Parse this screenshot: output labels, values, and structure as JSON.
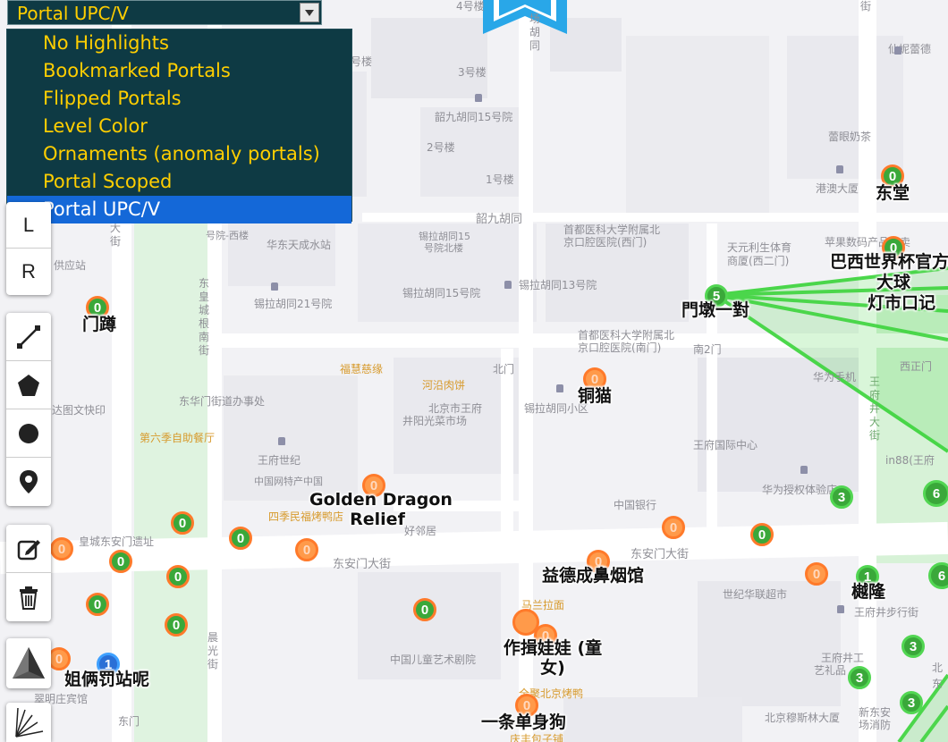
{
  "layer_select": {
    "selected": "Portal UPC/V",
    "options": [
      {
        "label": "No Highlights",
        "checked": false
      },
      {
        "label": "Bookmarked Portals",
        "checked": false
      },
      {
        "label": "Flipped Portals",
        "checked": false
      },
      {
        "label": "Level Color",
        "checked": false
      },
      {
        "label": "Ornaments (anomaly portals)",
        "checked": false
      },
      {
        "label": "Portal Scoped",
        "checked": false
      },
      {
        "label": "Portal UPC/V",
        "checked": true
      }
    ],
    "check_mark": "✓"
  },
  "toolbar": {
    "zoom_l": "L",
    "zoom_r": "R",
    "draw_icons": [
      "polyline-icon",
      "polygon-icon",
      "circle-icon",
      "marker-icon"
    ],
    "edit_icons": [
      "edit-icon",
      "trash-icon"
    ],
    "bottom_icons": [
      "layer-pyramid-icon",
      "starburst-icon"
    ]
  },
  "portal_labels": {
    "mendun": "門墩一對",
    "brazil": "巴西世界杯官方",
    "dadeng": "大球",
    "dengshi": "灯市口记",
    "dongtang": "东堂",
    "mendun2": "门蹲",
    "tongmao": "铜猫",
    "golden_dragon_1": "Golden Dragon",
    "golden_dragon_2": "Relief",
    "yide": "益德成鼻烟馆",
    "zuoyi_1": "作揖娃娃 (童",
    "zuoyi_2": "女)",
    "yitiao": "一条单身狗",
    "jiemei": "姐俩罚站呢",
    "jilong": "樾隆"
  },
  "portal_levels": {
    "p_dongtang": "0",
    "p_brazil": "0",
    "p_mendun": "5",
    "p_mendun2": "0",
    "p_tongmao": "0",
    "p_golden": "0",
    "p_a": "0",
    "p_b": "0",
    "p_c": "0",
    "p_d": "0",
    "p_e": "0",
    "p_f": "0",
    "p_g": "0",
    "p_h": "0",
    "p_i": "0",
    "p_j": "0",
    "p_k": "0",
    "p_l": "0",
    "p_m": "0",
    "p_n": "0",
    "p_o": "0",
    "p_p": "0",
    "p_q": "0",
    "p_r": "0",
    "p_s": "3",
    "p_t": "6",
    "p_u": "1",
    "p_v": "6",
    "p_w": "3",
    "p_x": "3",
    "p_y": "3",
    "p_z": "1"
  },
  "map_labels": {
    "l1": "4号楼",
    "l2": "场",
    "l3": "胡",
    "l4": "同",
    "l5": "仙妮蕾德",
    "l6": "号楼",
    "l7": "3号楼",
    "l8": "韶九胡同15号院",
    "l9": "蕾眼奶茶",
    "l10": "2号楼",
    "l11": "1号楼",
    "l12": "港澳大厦",
    "l13": "韶九胡同",
    "l14": "首都医科大学附属北",
    "l15": "京口腔医院(西门)",
    "l16": "锡拉胡同15",
    "l17": "号院北楼",
    "l18": "华东天成水站",
    "l19": "号院-西楼",
    "l20": "天元利生体育",
    "l21": "商厦(西二门)",
    "l22": "苹果数码产品专卖",
    "l23": "供应站",
    "l24": "锡拉胡同21号院",
    "l25": "锡拉胡同15号院",
    "l26": "锡拉胡同13号院",
    "l27": "首都医科大学附属北",
    "l28": "京口腔医院(南门)",
    "l29": "南2门",
    "l30": "福慧慈缘",
    "l31": "河沿肉饼",
    "l32": "北门",
    "l33": "华为手机",
    "l34": "西正门",
    "l35": "东华门街道办事处",
    "l36": "北京市王府",
    "l37": "井阳光菜市场",
    "l38": "锡拉胡同小区",
    "l39": "达图文快印",
    "l40": "第六季自助餐厅",
    "l41": "王府国际中心",
    "l42": "王府世纪",
    "l43": "in88(王府",
    "l44": "中国网特产中国",
    "l45": "华为授权体验店",
    "l46": "四季民福烤鸭店",
    "l47": "好邻居",
    "l48": "中国银行",
    "l49": "皇城东安门遗址",
    "l50": "东安门大街",
    "l51": "东安门大街",
    "l52": "马兰拉面",
    "l53": "世纪华联超市",
    "l54": "王府井步行街",
    "l55": "中国儿童艺术剧院",
    "l56": "王府井工",
    "l57": "艺礼品",
    "l58": "翠明庄宾馆",
    "l59": "东门",
    "l60": "全聚北京烤鸭",
    "l61": "北京穆斯林大厦",
    "l62": "新东安",
    "l63": "场消防",
    "l64": "庆丰包子铺",
    "l65": "北",
    "l66": "东"
  },
  "vertical_labels": {
    "v1": "东皇城根南街",
    "v2": "晨光街",
    "v3": "王府井大街",
    "v4": "大街",
    "v5": "街"
  }
}
